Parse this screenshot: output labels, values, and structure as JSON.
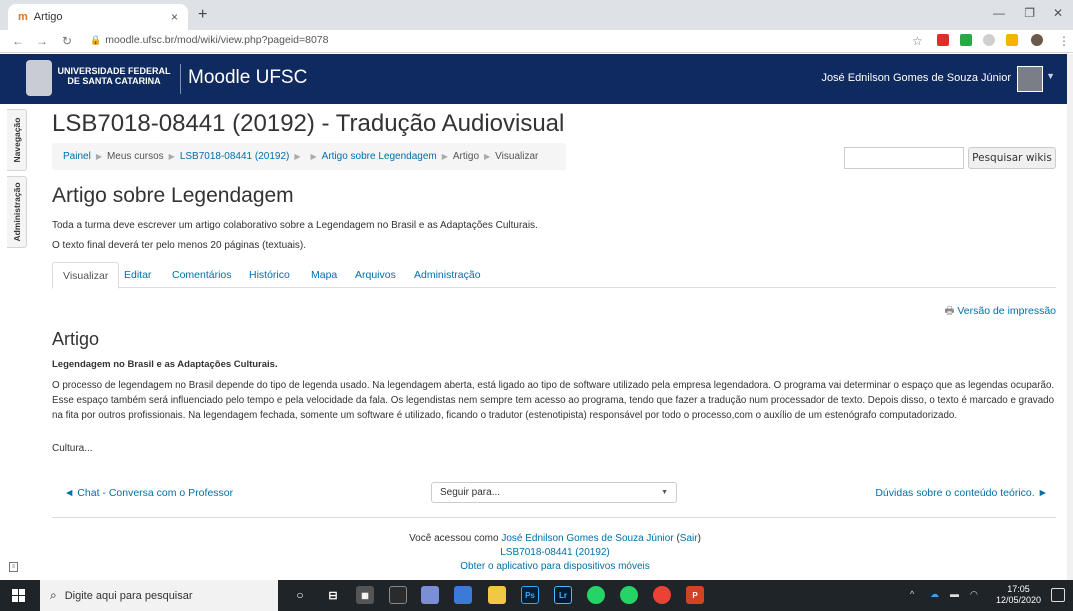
{
  "browser": {
    "tab_title": "Artigo",
    "tab_close": "×",
    "new_tab": "+",
    "url": "moodle.ufsc.br/mod/wiki/view.php?pageid=8078"
  },
  "header": {
    "university_line1": "UNIVERSIDADE FEDERAL",
    "university_line2": "DE SANTA CATARINA",
    "brand": "Moodle UFSC",
    "user_name": "José Ednilson Gomes de Souza Júnior"
  },
  "dock": {
    "nav_label": "Navegação",
    "admin_label": "Administração"
  },
  "course_title": "LSB7018-08441 (20192) - Tradução Audiovisual",
  "breadcrumb": {
    "items": [
      "Painel",
      "Meus cursos",
      "LSB7018-08441 (20192)",
      "",
      "Artigo sobre Legendagem",
      "Artigo",
      "Visualizar"
    ]
  },
  "search": {
    "button_label": "Pesquisar wikis",
    "placeholder": ""
  },
  "wiki": {
    "title": "Artigo sobre Legendagem",
    "intro_1": "Toda a turma deve escrever um artigo colaborativo sobre a Legendagem no Brasil e as Adaptações Culturais.",
    "intro_2": "O texto final deverá ter pelo menos 20 páginas (textuais).",
    "tabs": [
      "Visualizar",
      "Editar",
      "Comentários",
      "Histórico",
      "Mapa",
      "Arquivos",
      "Administração"
    ],
    "print_link": "Versão de impressão",
    "page_heading": "Artigo",
    "subheading": "Legendagem no Brasil e as Adaptações Culturais.",
    "body": "O processo de legendagem no Brasil depende do tipo de legenda usado. Na legendagem aberta, está ligado ao tipo de software utilizado pela empresa legendadora. O programa vai determinar o espaço que as legendas ocuparão. Esse espaço também será influenciado pelo tempo e pela velocidade da fala. Os legendistas nem sempre tem acesso ao programa, tendo que fazer a tradução num processador de texto. Depois disso, o texto é marcado e gravado na fita por outros profissionais. Na legendagem fechada, somente um software é utilizado, ficando o tradutor (estenotipista) responsável por todo o processo,com o auxílio de um estenógrafo computadorizado.",
    "body_tail": "Cultura..."
  },
  "activity_nav": {
    "prev": "◄ Chat - Conversa com o Professor",
    "jump_label": "Seguir para...",
    "next": "Dúvidas sobre o conteúdo teórico. ►"
  },
  "footer": {
    "logged_prefix": "Você acessou como ",
    "logged_user": "José Ednilson Gomes de Souza Júnior",
    "logout": "Sair",
    "course": "LSB7018-08441 (20192)",
    "mobile_app": "Obter o aplicativo para dispositivos móveis"
  },
  "taskbar": {
    "search_placeholder": "Digite aqui para pesquisar",
    "time": "17:05",
    "date": "12/05/2020"
  },
  "colors": {
    "header_bg": "#0f2a5f",
    "link": "#0070a8"
  }
}
